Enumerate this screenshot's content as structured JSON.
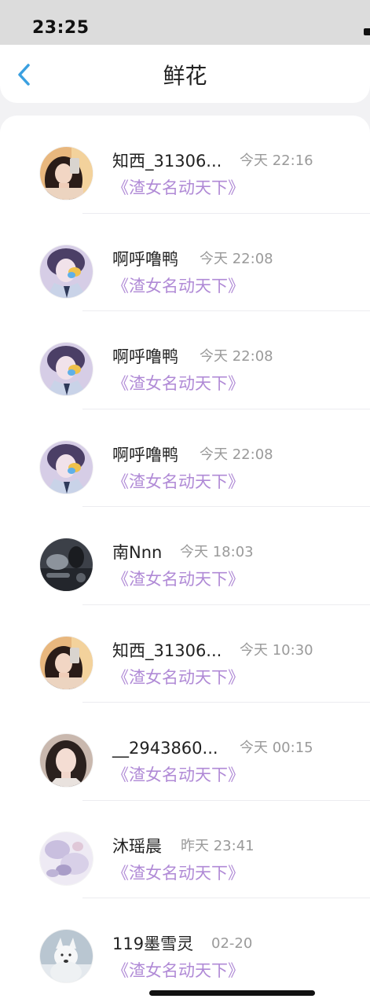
{
  "status_bar": {
    "time": "23:25"
  },
  "nav": {
    "title": "鲜花",
    "back_icon": "chevron-left-icon",
    "accent": "#3aa0e0"
  },
  "colors": {
    "book_link": "#b08ad6",
    "time_text": "#9a9a9a"
  },
  "items": [
    {
      "name": "知西_31306...",
      "time": "今天 22:16",
      "book": "《渣女名动天下》",
      "avatar": "avatar-girl-selfie"
    },
    {
      "name": "啊呼噜鸭",
      "time": "今天 22:08",
      "book": "《渣女名动天下》",
      "avatar": "avatar-anime-boy"
    },
    {
      "name": "啊呼噜鸭",
      "time": "今天 22:08",
      "book": "《渣女名动天下》",
      "avatar": "avatar-anime-boy"
    },
    {
      "name": "啊呼噜鸭",
      "time": "今天 22:08",
      "book": "《渣女名动天下》",
      "avatar": "avatar-anime-boy"
    },
    {
      "name": "南Nnn",
      "time": "今天 18:03",
      "book": "《渣女名动天下》",
      "avatar": "avatar-dark-photo"
    },
    {
      "name": "知西_31306...",
      "time": "今天 10:30",
      "book": "《渣女名动天下》",
      "avatar": "avatar-girl-selfie"
    },
    {
      "name": "__2943860...",
      "time": "今天 00:15",
      "book": "《渣女名动天下》",
      "avatar": "avatar-girl-portrait"
    },
    {
      "name": "沐瑶晨",
      "time": "昨天 23:41",
      "book": "《渣女名动天下》",
      "avatar": "avatar-pale-illustration"
    },
    {
      "name": "119墨雪灵",
      "time": "02-20",
      "book": "《渣女名动天下》",
      "avatar": "avatar-white-wolf"
    }
  ]
}
